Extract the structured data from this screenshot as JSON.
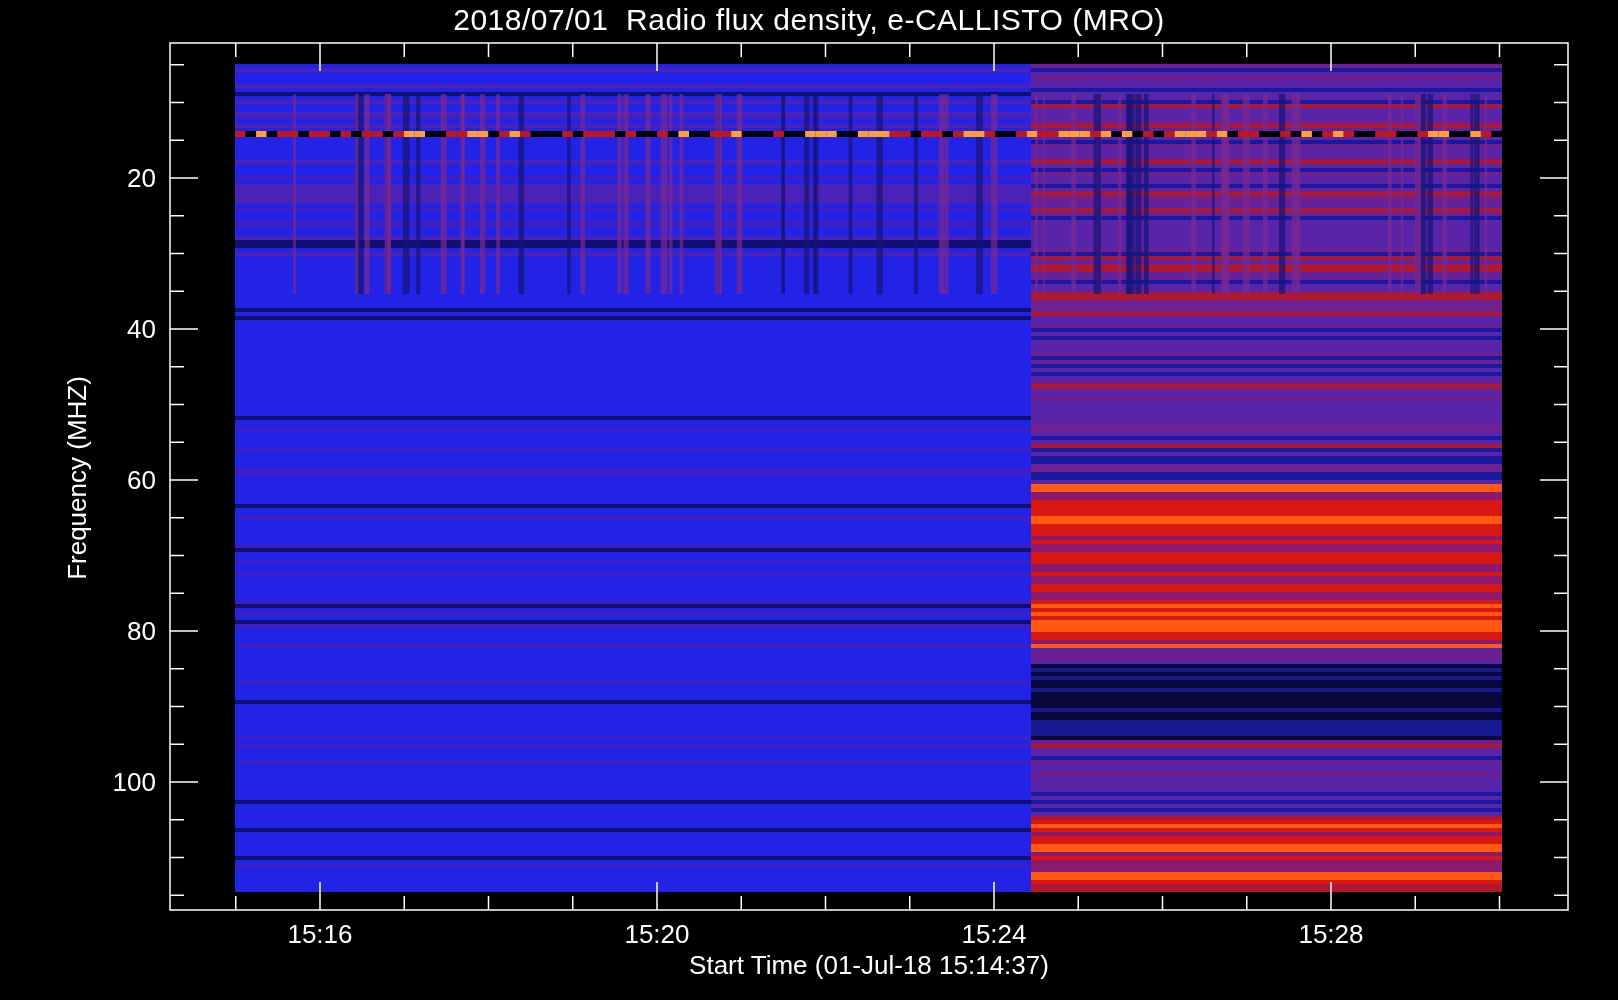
{
  "plot": {
    "title": "2018/07/01  Radio flux density, e-CALLISTO (MRO)",
    "xlabel": "Start Time (01-Jul-18 15:14:37)",
    "ylabel": "Frequency (MHZ)",
    "x_ticks": [
      "15:16",
      "15:20",
      "15:24",
      "15:28"
    ],
    "y_ticks": [
      "20",
      "40",
      "60",
      "80",
      "100"
    ]
  }
}
